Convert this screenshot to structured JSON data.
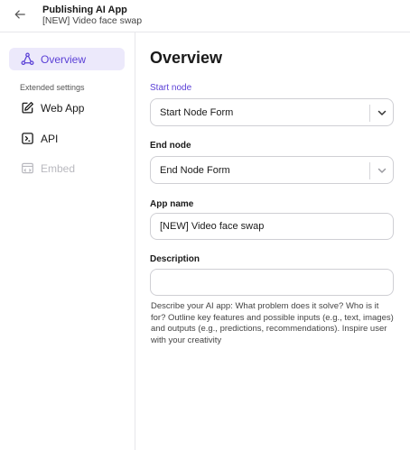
{
  "header": {
    "title": "Publishing AI App",
    "subtitle": "[NEW] Video face swap",
    "back_icon": "arrow-left-icon"
  },
  "sidebar": {
    "items": [
      {
        "label": "Overview",
        "icon": "workflow-icon",
        "state": "active"
      },
      {
        "label": "Web App",
        "icon": "edit-icon",
        "state": "normal"
      },
      {
        "label": "API",
        "icon": "api-icon",
        "state": "normal"
      },
      {
        "label": "Embed",
        "icon": "embed-icon",
        "state": "disabled"
      }
    ],
    "section_label": "Extended settings"
  },
  "main": {
    "title": "Overview",
    "start_node": {
      "label": "Start node",
      "value": "Start Node Form"
    },
    "end_node": {
      "label": "End node",
      "value": "End Node Form"
    },
    "app_name": {
      "label": "App name",
      "value": "[NEW] Video face swap"
    },
    "description": {
      "label": "Description",
      "value": "",
      "help": "Describe your AI app: What problem does it solve? Who is it for? Outline key features and possible inputs (e.g., text, images) and outputs (e.g., predictions, recommendations). Inspire user with your creativity"
    }
  },
  "colors": {
    "accent": "#5a3fd6",
    "active_bg": "#ece9fb",
    "border": "#cfcfd4",
    "disabled": "#b9b9bf"
  }
}
